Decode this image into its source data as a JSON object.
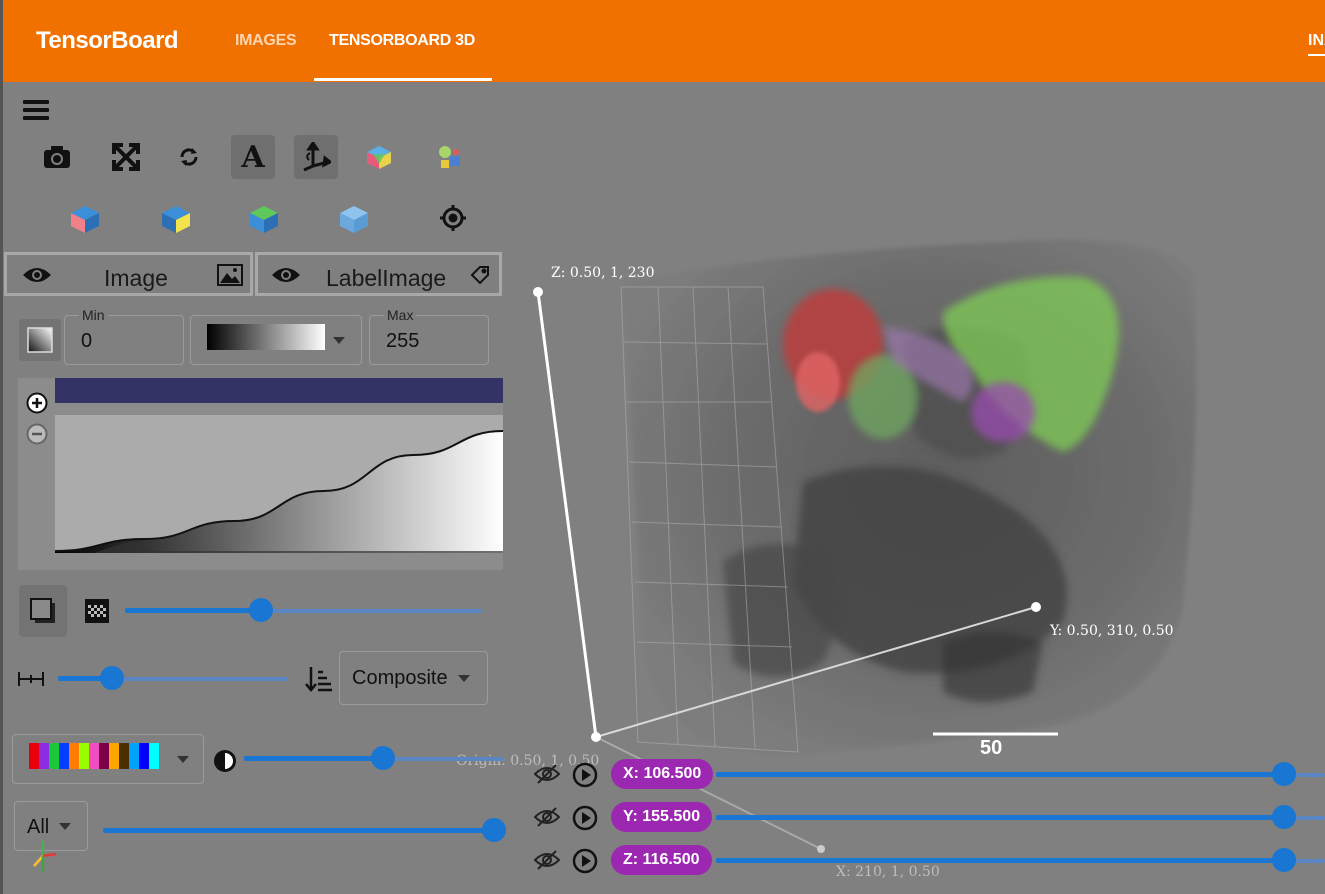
{
  "app": {
    "title": "TensorBoard"
  },
  "nav": {
    "tabs": [
      {
        "label": "IMAGES",
        "active": false
      },
      {
        "label": "TENSORBOARD 3D",
        "active": true
      }
    ],
    "cut_tab": "INA"
  },
  "toolbar": {
    "row1_icons": [
      "camera-icon",
      "fullscreen-icon",
      "rotate-icon",
      "annotation-text-icon",
      "axes-icon",
      "colored-cube-icon",
      "segment-colors-icon"
    ],
    "row2_icons": [
      "cube-red-face-icon",
      "cube-yellow-face-icon",
      "cube-green-face-icon",
      "cube-blue-icon",
      "target-icon"
    ]
  },
  "layers": {
    "image": {
      "label": "Image"
    },
    "label_image": {
      "label": "LabelImage"
    }
  },
  "range": {
    "min_label": "Min",
    "min_value": "0",
    "max_label": "Max",
    "max_value": "255"
  },
  "transfer_function": {
    "opacity_curve": [
      [
        0,
        0.0
      ],
      [
        0.2,
        0.1
      ],
      [
        0.4,
        0.25
      ],
      [
        0.6,
        0.5
      ],
      [
        0.8,
        0.8
      ],
      [
        1.0,
        1.0
      ]
    ]
  },
  "controls": {
    "shadow_slider": 0.38,
    "sample_distance_slider": 0.2,
    "blend_mode": "Composite",
    "label_opacity_slider": 0.5,
    "label_select": "All",
    "label_select_slider": 1.0
  },
  "label_palette": [
    "#e8000b",
    "#8b2be2",
    "#1ac938",
    "#023eff",
    "#ff7c00",
    "#9aff00",
    "#f14cc1",
    "#7a0047",
    "#ffa500",
    "#4a3000",
    "#00a2ff",
    "#0000ff",
    "#00ffff"
  ],
  "axes": {
    "z_label": "Z: 0.50, 1, 230",
    "y_label": "Y: 0.50, 310, 0.50",
    "x_label": "X: 210, 1, 0.50",
    "origin_label": "Origin: 0.50, 1, 0.50",
    "scale_bar": "50"
  },
  "slices": [
    {
      "label": "X: 106.500",
      "position": 0.94
    },
    {
      "label": "Y: 155.500",
      "position": 0.94
    },
    {
      "label": "Z: 116.500",
      "position": 0.94
    }
  ],
  "colors": {
    "accent": "#1976d2",
    "header": "#f07000",
    "pill": "#9c27b0"
  }
}
